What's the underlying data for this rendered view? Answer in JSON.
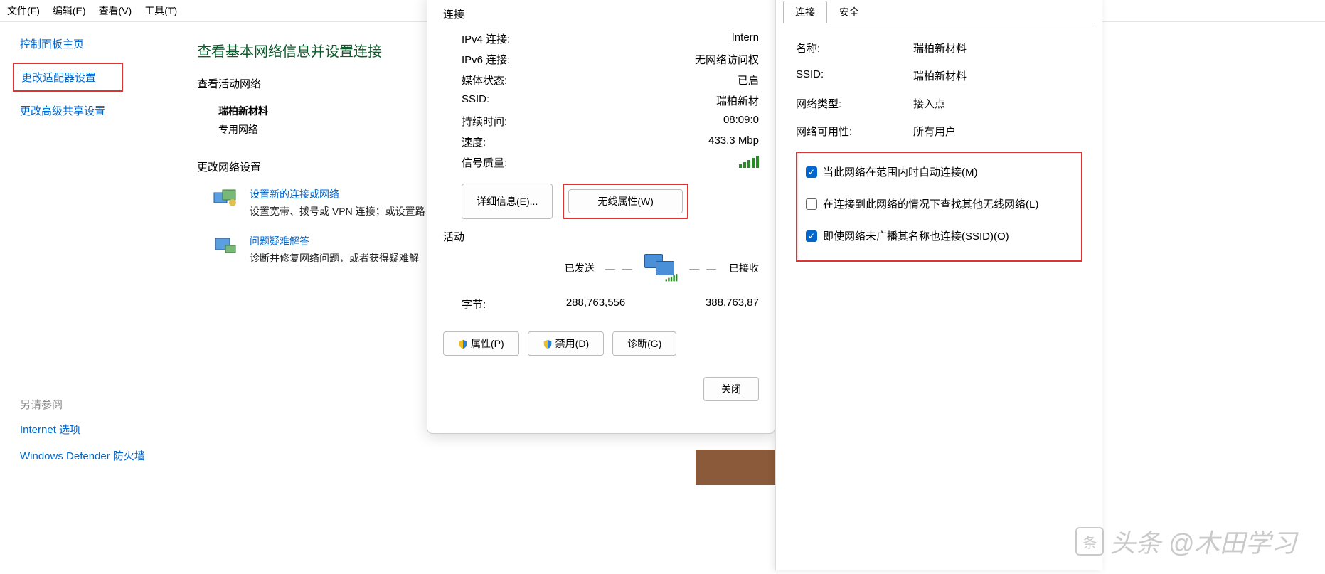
{
  "menubar": [
    "文件(F)",
    "编辑(E)",
    "查看(V)",
    "工具(T)"
  ],
  "sidebar": {
    "home": "控制面板主页",
    "adapter": "更改适配器设置",
    "sharing": "更改高级共享设置"
  },
  "seealso": {
    "header": "另请参阅",
    "internet": "Internet 选项",
    "defender": "Windows Defender 防火墙"
  },
  "content": {
    "title": "查看基本网络信息并设置连接",
    "active_header": "查看活动网络",
    "net_name": "瑞柏新材料",
    "net_type": "专用网络",
    "change_header": "更改网络设置",
    "new_conn": {
      "link": "设置新的连接或网络",
      "desc": "设置宽带、拨号或 VPN 连接；或设置路"
    },
    "troubleshoot": {
      "link": "问题疑难解答",
      "desc": "诊断并修复网络问题，或者获得疑难解"
    }
  },
  "dialog1": {
    "conn_header": "连接",
    "rows": {
      "ipv4_l": "IPv4 连接:",
      "ipv4_v": "Intern",
      "ipv6_l": "IPv6 连接:",
      "ipv6_v": "无网络访问权",
      "media_l": "媒体状态:",
      "media_v": "已启",
      "ssid_l": "SSID:",
      "ssid_v": "瑞柏新材",
      "dur_l": "持续时间:",
      "dur_v": "08:09:0",
      "speed_l": "速度:",
      "speed_v": "433.3 Mbp",
      "signal_l": "信号质量:"
    },
    "details_btn": "详细信息(E)...",
    "wireless_btn": "无线属性(W)",
    "activity_header": "活动",
    "sent": "已发送",
    "recv": "已接收",
    "bytes_l": "字节:",
    "bytes_sent": "288,763,556",
    "bytes_recv": "388,763,87",
    "props_btn": "属性(P)",
    "disable_btn": "禁用(D)",
    "diag_btn": "诊断(G)",
    "close_btn": "关闭"
  },
  "dialog2": {
    "tabs": {
      "conn": "连接",
      "sec": "安全"
    },
    "rows": {
      "name_l": "名称:",
      "name_v": "瑞柏新材料",
      "ssid_l": "SSID:",
      "ssid_v": "瑞柏新材料",
      "type_l": "网络类型:",
      "type_v": "接入点",
      "avail_l": "网络可用性:",
      "avail_v": "所有用户"
    },
    "checks": {
      "auto": "当此网络在范围内时自动连接(M)",
      "lookother": "在连接到此网络的情况下查找其他无线网络(L)",
      "broadcast": "即使网络未广播其名称也连接(SSID)(O)"
    }
  },
  "watermark": "头条 @木田学习"
}
